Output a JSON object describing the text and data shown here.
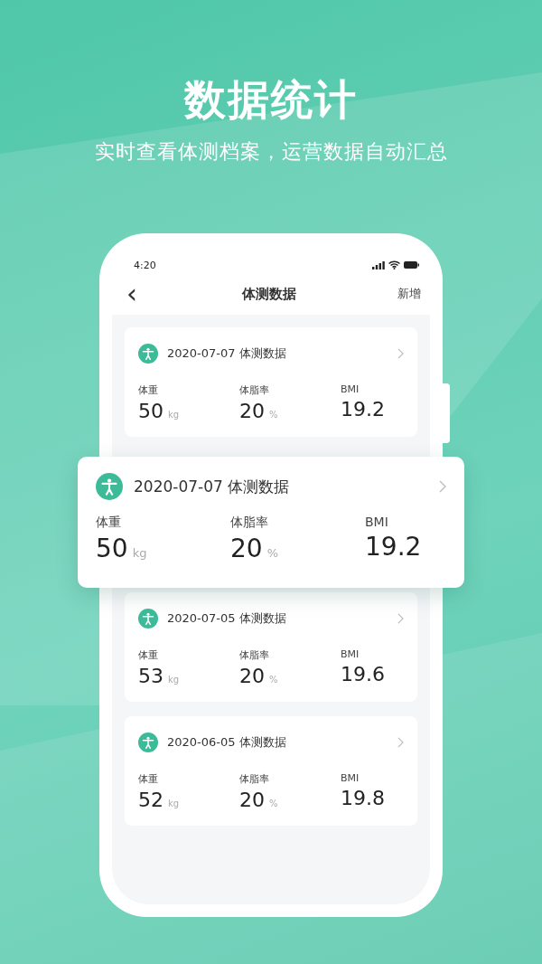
{
  "hero": {
    "title": "数据统计",
    "subtitle": "实时查看体测档案，运营数据自动汇总"
  },
  "status_bar": {
    "time": "4:20"
  },
  "nav": {
    "back": "‹",
    "title": "体测数据",
    "action": "新增"
  },
  "records": [
    {
      "title": "2020-07-07 体测数据",
      "stats": [
        {
          "label": "体重",
          "value": "50",
          "unit": "kg"
        },
        {
          "label": "体脂率",
          "value": "20",
          "unit": "%"
        },
        {
          "label": "BMI",
          "value": "19.2"
        }
      ]
    },
    {
      "title": "2020-07-05 体测数据",
      "stats": [
        {
          "label": "体重",
          "value": "53",
          "unit": "kg"
        },
        {
          "label": "体脂率",
          "value": "20",
          "unit": "%"
        },
        {
          "label": "BMI",
          "value": "19.6"
        }
      ]
    },
    {
      "title": "2020-06-05 体测数据",
      "stats": [
        {
          "label": "体重",
          "value": "52",
          "unit": "kg"
        },
        {
          "label": "体脂率",
          "value": "20",
          "unit": "%"
        },
        {
          "label": "BMI",
          "value": "19.8"
        }
      ]
    }
  ],
  "highlighted_record": {
    "title": "2020-07-07 体测数据",
    "stats": [
      {
        "label": "体重",
        "value": "50",
        "unit": "kg"
      },
      {
        "label": "体脂率",
        "value": "20",
        "unit": "%"
      },
      {
        "label": "BMI",
        "value": "19.2"
      }
    ]
  }
}
